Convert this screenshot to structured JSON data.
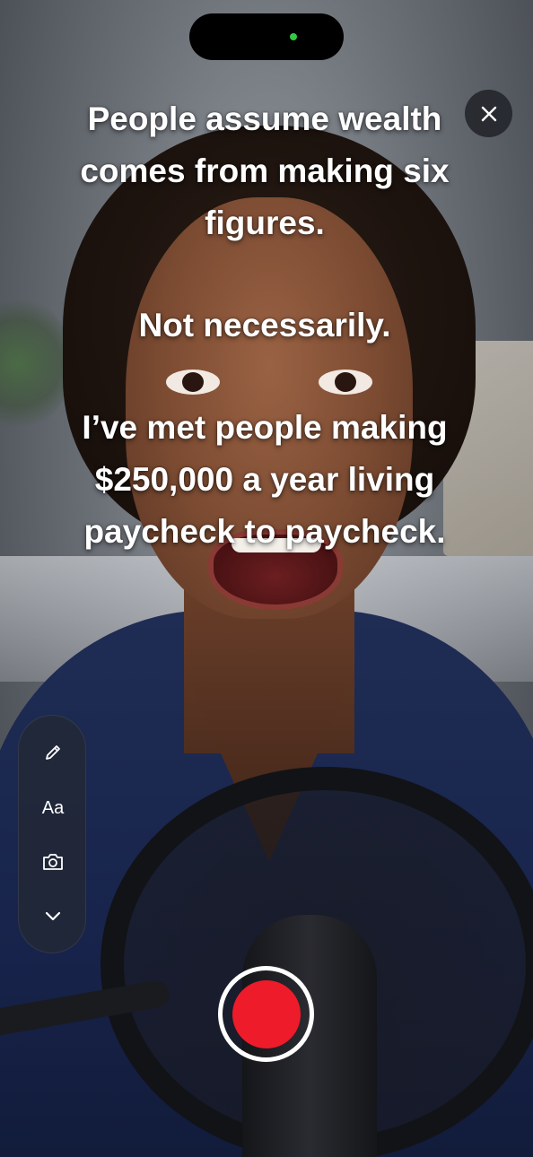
{
  "colors": {
    "record": "#ee1b2a",
    "camera_indicator": "#2ecc40",
    "toolbar_bg": "#232834",
    "caption_text": "#ffffff"
  },
  "caption": {
    "paragraph1": "People assume wealth comes from making six figures.",
    "paragraph2": "Not necessarily.",
    "paragraph3": "I’ve met people making $250,000 a year living paycheck to paycheck."
  },
  "toolbar": {
    "items": [
      {
        "icon": "pencil-icon"
      },
      {
        "icon": "text-style-icon",
        "label": "Aa"
      },
      {
        "icon": "camera-icon"
      },
      {
        "icon": "chevron-down-icon"
      }
    ]
  },
  "controls": {
    "close_icon": "close-icon",
    "record_icon": "record-icon"
  }
}
